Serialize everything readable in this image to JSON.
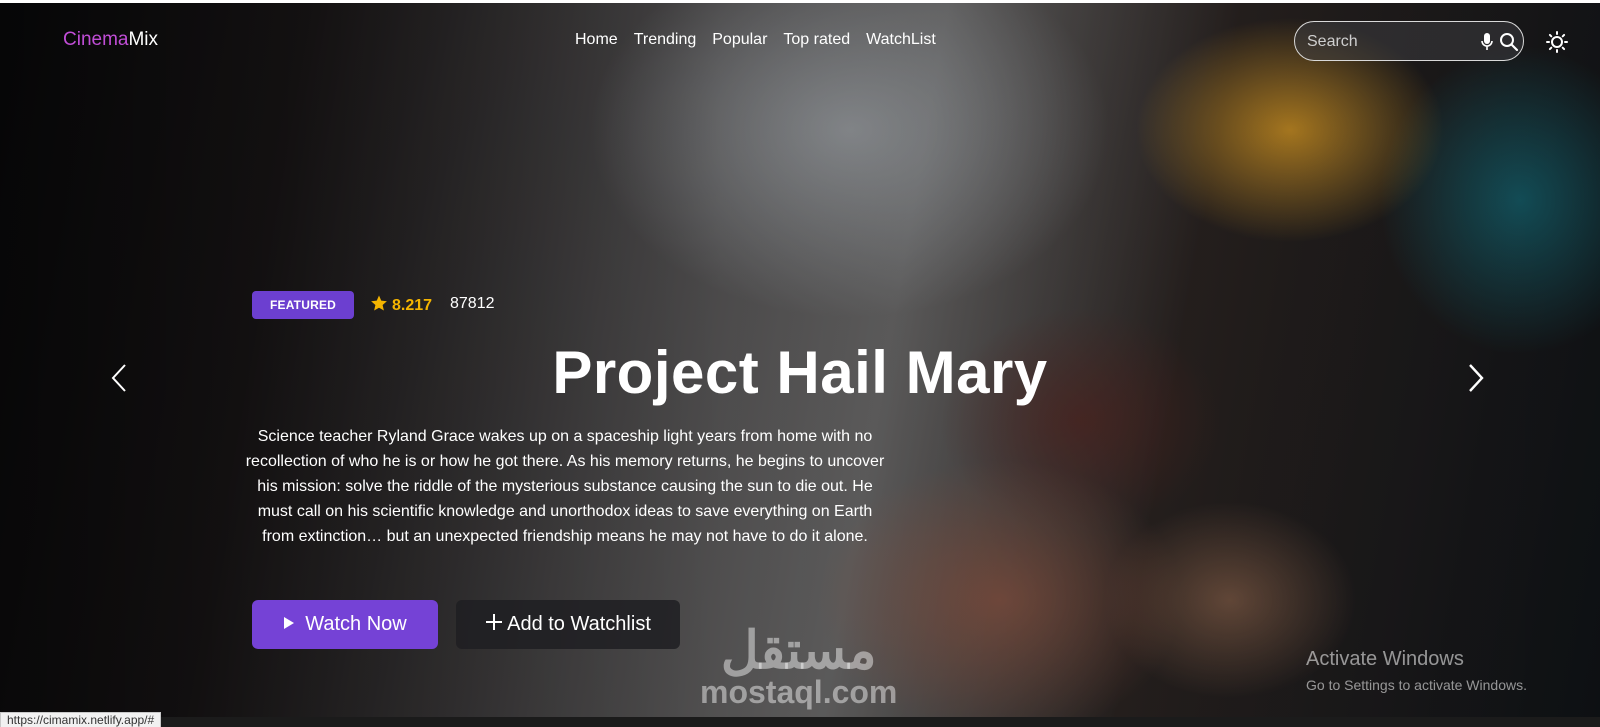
{
  "brand": {
    "part1": "Cinema",
    "part2": "Mix"
  },
  "nav": {
    "items": [
      {
        "label": "Home"
      },
      {
        "label": "Trending"
      },
      {
        "label": "Popular"
      },
      {
        "label": "Top rated"
      },
      {
        "label": "WatchList"
      }
    ]
  },
  "search": {
    "placeholder": "Search",
    "mic_icon": "mic-icon",
    "search_icon": "search-icon"
  },
  "theme_toggle": {
    "icon": "sun-icon"
  },
  "hero": {
    "badge": "FEATURED",
    "rating": "8.217",
    "votes": "87812",
    "title": "Project Hail Mary",
    "overview": "Science teacher Ryland Grace wakes up on a spaceship light years from home with no recollection of who he is or how he got there. As his memory returns, he begins to uncover his mission: solve the riddle of the mysterious substance causing the sun to die out. He must call on his scientific knowledge and unorthodox ideas to save everything on Earth from extinction… but an unexpected friendship means he may not have to do it alone.",
    "watch_now": "Watch Now",
    "add_watchlist": "Add to Watchlist"
  },
  "watermark": {
    "arabic": "مستقل",
    "latin": "mostaql.com"
  },
  "windows_notice": {
    "line1": "Activate Windows",
    "line2": "Go to Settings to activate Windows."
  },
  "status_url": "https://cimamix.netlify.app/#",
  "colors": {
    "accent": "#7542d6",
    "brand": "#c04dd6",
    "star": "#f4b400"
  }
}
